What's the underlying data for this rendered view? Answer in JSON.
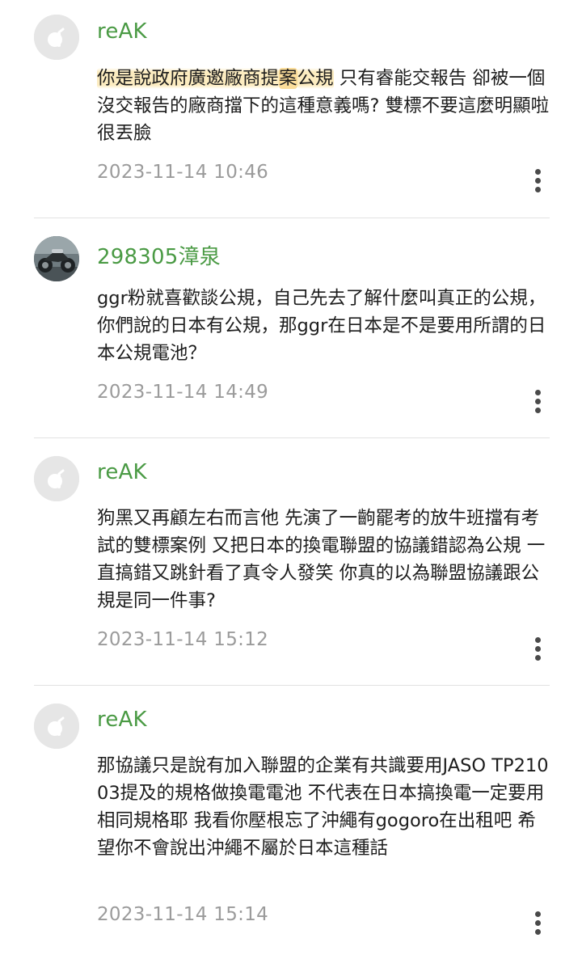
{
  "comments": [
    {
      "username": "reAK",
      "avatar_icon": "default-user-avatar-icon",
      "highlight_a": "你是說政府廣邀廠商提",
      "highlight_b": "案",
      "highlight_c": "公規",
      "text_rest": " 只有睿能交報告 卻被一個沒交報告的廠商擋下的這種意義嗎? 雙標不要這麼明顯啦 很丟臉",
      "timestamp": "2023-11-14 10:46",
      "more_icon": "more-vertical-icon"
    },
    {
      "username": "298305漳泉",
      "avatar_icon": "motorcycle-photo-avatar-icon",
      "text": "ggr粉就喜歡談公規，自己先去了解什麼叫真正的公規，你們說的日本有公規，那ggr在日本是不是要用所謂的日本公規電池？",
      "timestamp": "2023-11-14 14:49",
      "more_icon": "more-vertical-icon"
    },
    {
      "username": "reAK",
      "avatar_icon": "default-user-avatar-icon",
      "text": "狗黑又再顧左右而言他 先演了一齣罷考的放牛班擋有考試的雙標案例 又把日本的換電聯盟的協議錯認為公規 一直搞錯又跳針看了真令人發笑 你真的以為聯盟協議跟公規是同一件事?",
      "timestamp": "2023-11-14 15:12",
      "more_icon": "more-vertical-icon"
    },
    {
      "username": "reAK",
      "avatar_icon": "default-user-avatar-icon",
      "text": "那協議只是說有加入聯盟的企業有共識要用JASO TP21003提及的規格做換電電池 不代表在日本搞換電一定要用相同規格耶 我看你壓根忘了沖繩有gogoro在出租吧 希望你不會說出沖繩不屬於日本這種話",
      "timestamp": "2023-11-14 15:14",
      "more_icon": "more-vertical-icon"
    }
  ],
  "colors": {
    "username": "#4a9a44",
    "timestamp": "#9b9b9b",
    "highlight": "#fadc8c",
    "divider": "#e2e2e2"
  }
}
